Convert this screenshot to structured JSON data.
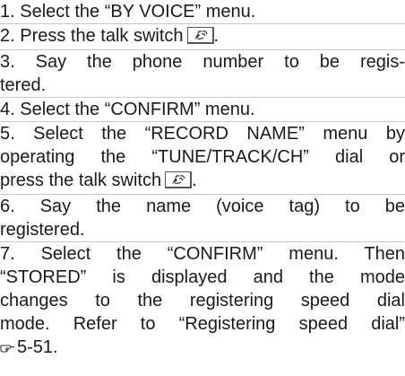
{
  "steps": [
    {
      "lines": [
        "1.  Select the “BY VOICE” menu."
      ]
    },
    {
      "lines": [
        "2.  Press the talk switch"
      ],
      "after_icon": "."
    },
    {
      "lines": [
        "3.  Say the phone number to be regis-",
        "tered."
      ]
    },
    {
      "lines": [
        "4.  Select the “CONFIRM” menu."
      ]
    },
    {
      "lines": [
        "5.  Select the “RECORD NAME” menu by",
        "operating the “TUNE/TRACK/CH” dial or",
        "press the talk switch"
      ],
      "after_icon": "."
    },
    {
      "lines": [
        "6.  Say the name (voice tag) to be",
        "registered."
      ]
    },
    {
      "lines": [
        "7.  Select the “CONFIRM” menu. Then",
        "“STORED” is displayed and the mode",
        "changes to the registering speed dial",
        "mode. Refer to “Registering speed dial”"
      ],
      "ref_page": "5-51."
    }
  ],
  "icons": {
    "talk_switch": "talk-switch-icon",
    "page_reference": "pointing-hand-icon"
  }
}
